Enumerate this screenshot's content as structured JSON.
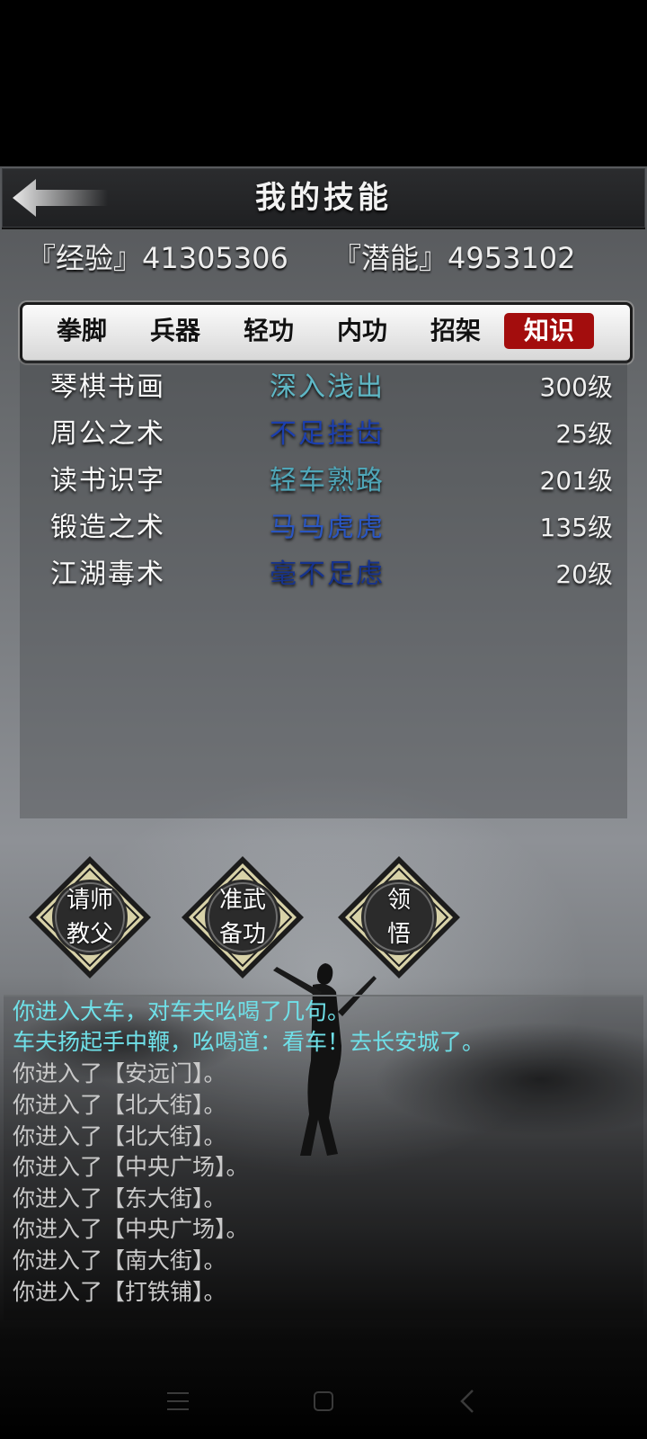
{
  "header": {
    "title": "我的技能",
    "back_icon": "back-arrow-icon"
  },
  "stats": {
    "exp_label": "『经验』41305306",
    "potential_label": "『潜能』4953102"
  },
  "tabs": [
    {
      "label": "拳脚",
      "active": false
    },
    {
      "label": "兵器",
      "active": false
    },
    {
      "label": "轻功",
      "active": false
    },
    {
      "label": "内功",
      "active": false
    },
    {
      "label": "招架",
      "active": false
    },
    {
      "label": "知识",
      "active": true
    }
  ],
  "skills": [
    {
      "name": "琴棋书画",
      "rank": "深入浅出",
      "rank_color": "#5fb8c6",
      "level": "300级"
    },
    {
      "name": "周公之术",
      "rank": "不足挂齿",
      "rank_color": "#1c3fae",
      "level": "25级"
    },
    {
      "name": "读书识字",
      "rank": "轻车熟路",
      "rank_color": "#4fa6b8",
      "level": "201级"
    },
    {
      "name": "锻造之术",
      "rank": "马马虎虎",
      "rank_color": "#2a56c2",
      "level": "135级"
    },
    {
      "name": "江湖毒术",
      "rank": "毫不足虑",
      "rank_color": "#16338e",
      "level": "20级"
    }
  ],
  "actions": [
    {
      "line1": "请师",
      "line2": "教父"
    },
    {
      "line1": "准武",
      "line2": "备功"
    },
    {
      "line1": "领",
      "line2": "悟"
    }
  ],
  "log": [
    {
      "text": "你进入大车，对车夫吆喝了几句。",
      "highlight": true
    },
    {
      "text": "车夫扬起手中鞭，吆喝道：看车！去长安城了。",
      "highlight": true
    },
    {
      "text": "你进入了【安远门】。",
      "highlight": false
    },
    {
      "text": "你进入了【北大街】。",
      "highlight": false
    },
    {
      "text": "你进入了【北大街】。",
      "highlight": false
    },
    {
      "text": "你进入了【中央广场】。",
      "highlight": false
    },
    {
      "text": "你进入了【东大街】。",
      "highlight": false
    },
    {
      "text": "你进入了【中央广场】。",
      "highlight": false
    },
    {
      "text": "你进入了【南大街】。",
      "highlight": false
    },
    {
      "text": "你进入了【打铁铺】。",
      "highlight": false
    }
  ],
  "navbar": {
    "menu_icon": "menu-icon",
    "home_icon": "home-icon",
    "back_icon": "back-icon"
  },
  "colors": {
    "active_tab": "#a30d0d",
    "log_highlight": "#6fe0e8",
    "log_normal": "#c9c9c9"
  }
}
